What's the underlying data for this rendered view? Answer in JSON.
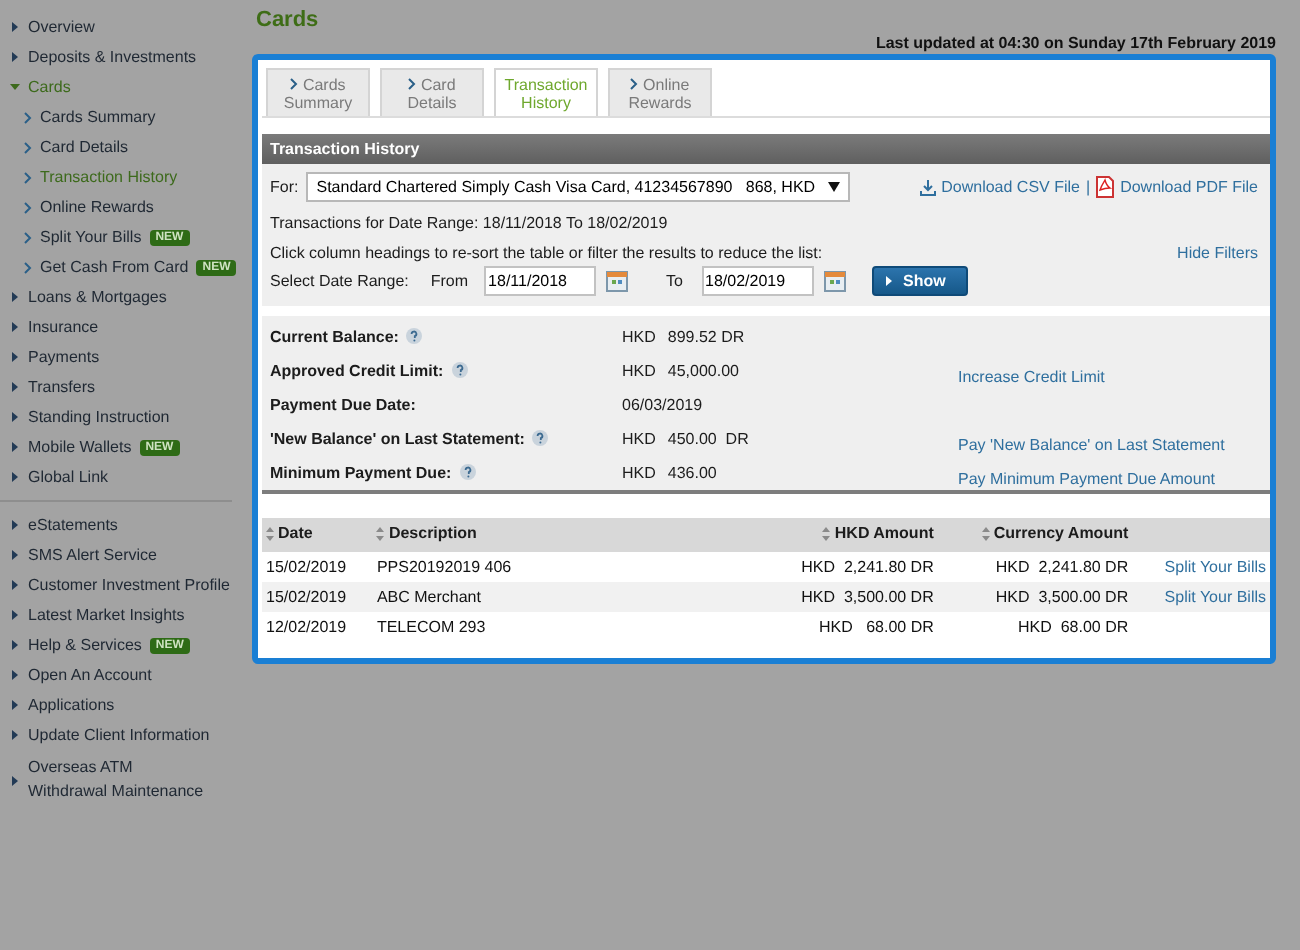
{
  "sidebar": {
    "groups": [
      [
        {
          "label": "Overview",
          "selected": false
        },
        {
          "label": "Deposits & Investments",
          "selected": false
        },
        {
          "label": "Cards",
          "selected": true,
          "expanded": true,
          "children": [
            {
              "label": "Cards Summary",
              "selected": false
            },
            {
              "label": "Card Details",
              "selected": false
            },
            {
              "label": "Transaction History",
              "selected": true
            },
            {
              "label": "Online Rewards",
              "selected": false
            },
            {
              "label": "Split Your Bills",
              "selected": false,
              "badge": "NEW"
            },
            {
              "label": "Get Cash From Card",
              "selected": false,
              "badge": "NEW"
            }
          ]
        },
        {
          "label": "Loans & Mortgages",
          "selected": false
        },
        {
          "label": "Insurance",
          "selected": false
        },
        {
          "label": "Payments",
          "selected": false
        },
        {
          "label": "Transfers",
          "selected": false
        },
        {
          "label": "Standing Instruction",
          "selected": false
        },
        {
          "label": "Mobile Wallets",
          "selected": false,
          "badge": "NEW"
        },
        {
          "label": "Global Link",
          "selected": false
        }
      ],
      [
        {
          "label": "eStatements",
          "selected": false
        },
        {
          "label": "SMS Alert Service",
          "selected": false
        },
        {
          "label": "Customer Investment Profile",
          "selected": false
        },
        {
          "label": "Latest Market Insights",
          "selected": false
        },
        {
          "label": "Help & Services",
          "selected": false,
          "badge": "NEW"
        },
        {
          "label": "Open An Account",
          "selected": false
        },
        {
          "label": "Applications",
          "selected": false
        },
        {
          "label": "Update Client Information",
          "selected": false
        },
        {
          "label": "Overseas ATM Withdrawal Maintenance",
          "selected": false
        }
      ]
    ]
  },
  "page_title": "Cards",
  "last_updated": "Last updated at 04:30 on Sunday 17th February 2019",
  "tabs": [
    {
      "label": "Cards Summary",
      "selected": false
    },
    {
      "label": "Card Details",
      "selected": false
    },
    {
      "label": "Transaction History",
      "selected": true
    },
    {
      "label": "Online Rewards",
      "selected": false
    }
  ],
  "section_title": "Transaction History",
  "account": {
    "label": "For:",
    "value": "Standard Chartered Simply Cash Visa Card, 41234567890   868, HKD"
  },
  "downloads": [
    {
      "kind": "csv",
      "label": "Download CSV File"
    },
    {
      "kind": "pdf",
      "label": "Download PDF File"
    }
  ],
  "downloads_separator": "|",
  "date_range_text": "Transactions for Date Range: 18/11/2018 To 18/02/2019",
  "instructions": "Click column headings to re-sort the table or filter the results to reduce the list:",
  "hide_filters": "Hide Filters",
  "filter": {
    "label": "Select Date Range:",
    "from_label": "From",
    "from": "18/11/2018",
    "to_label": "To",
    "to": "18/02/2019",
    "button": "Show"
  },
  "summary": [
    {
      "label": "Current Balance:",
      "help": true,
      "currency": "HKD",
      "amount": "899.52 DR"
    },
    {
      "label": "Approved Credit Limit:",
      "help": true,
      "currency": "HKD",
      "amount": "45,000.00",
      "link": "Increase Credit Limit"
    },
    {
      "label": "Payment Due Date:",
      "help": false,
      "amount": "06/03/2019"
    },
    {
      "label": "'New Balance' on Last Statement:",
      "help": true,
      "currency": "HKD",
      "amount": "450.00  DR",
      "link": "Pay 'New Balance' on Last Statement"
    },
    {
      "label": "Minimum Payment Due:",
      "help": true,
      "currency": "HKD",
      "amount": "436.00",
      "link": "Pay Minimum Payment Due Amount"
    }
  ],
  "table": {
    "columns": [
      "Date",
      "Description",
      "HKD Amount",
      "Currency Amount"
    ],
    "rows": [
      {
        "date": "15/02/2019",
        "description": "PPS20192019 406",
        "hkd_amount": "HKD  2,241.80 DR",
        "currency_amount": "HKD  2,241.80 DR",
        "action": "Split Your Bills"
      },
      {
        "date": "15/02/2019",
        "description": "ABC Merchant",
        "hkd_amount": "HKD  3,500.00 DR",
        "currency_amount": "HKD  3,500.00 DR",
        "action": "Split Your Bills"
      },
      {
        "date": "12/02/2019",
        "description": "TELECOM 293",
        "hkd_amount": "HKD   68.00 DR",
        "currency_amount": "HKD  68.00 DR"
      }
    ]
  }
}
